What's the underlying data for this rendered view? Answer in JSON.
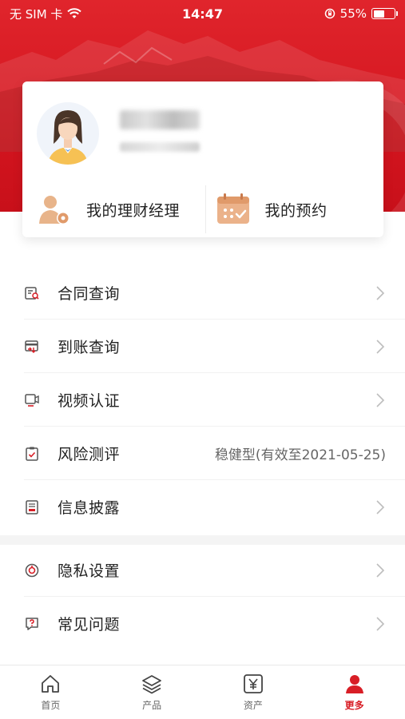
{
  "status_bar": {
    "carrier": "无 SIM 卡",
    "time": "14:47",
    "battery": "55%",
    "battery_level": 0.55
  },
  "profile": {
    "actions": [
      {
        "label": "我的理财经理",
        "icon": "advisor-icon"
      },
      {
        "label": "我的预约",
        "icon": "calendar-icon"
      }
    ]
  },
  "menu_group1": [
    {
      "label": "合同查询",
      "icon": "contract-search-icon",
      "value": ""
    },
    {
      "label": "到账查询",
      "icon": "arrival-query-icon",
      "value": ""
    },
    {
      "label": "视频认证",
      "icon": "video-auth-icon",
      "value": ""
    },
    {
      "label": "风险测评",
      "icon": "risk-assessment-icon",
      "value": "稳健型(有效至2021-05-25)"
    },
    {
      "label": "信息披露",
      "icon": "disclosure-icon",
      "value": ""
    }
  ],
  "menu_group2": [
    {
      "label": "隐私设置",
      "icon": "privacy-icon",
      "value": ""
    },
    {
      "label": "常见问题",
      "icon": "faq-icon",
      "value": ""
    }
  ],
  "tabbar": [
    {
      "label": "首页",
      "icon": "home-icon",
      "active": false
    },
    {
      "label": "产品",
      "icon": "layers-icon",
      "active": false
    },
    {
      "label": "资产",
      "icon": "yuan-icon",
      "active": false
    },
    {
      "label": "更多",
      "icon": "user-icon",
      "active": true
    }
  ],
  "colors": {
    "accent": "#d81e26",
    "header_red": "#d4151f"
  }
}
